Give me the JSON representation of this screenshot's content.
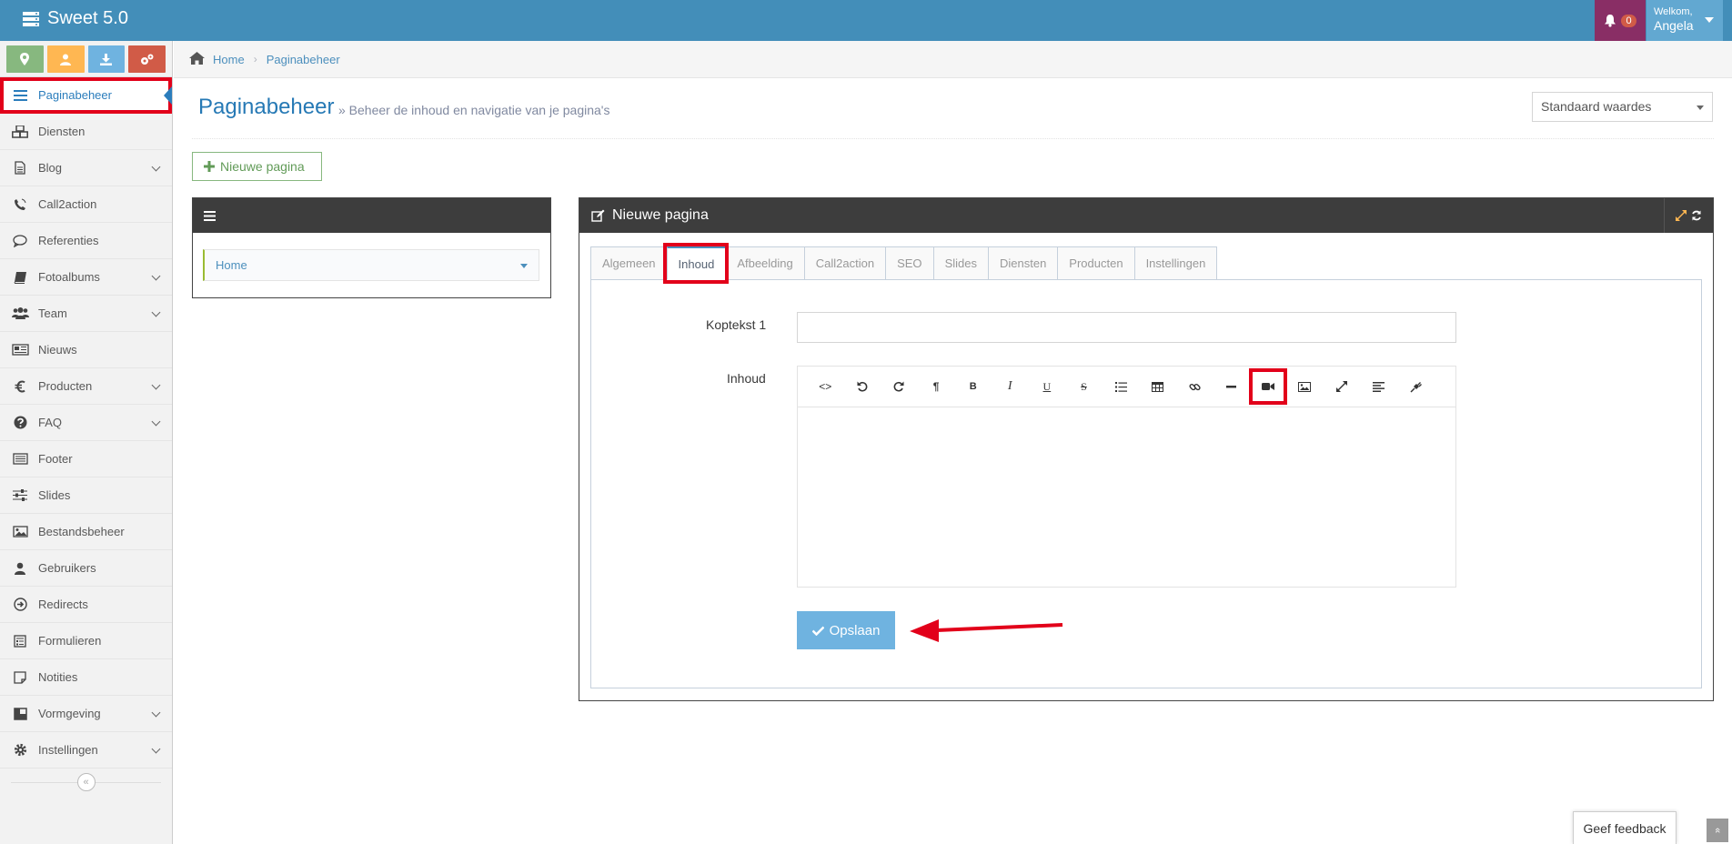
{
  "app": {
    "title": "Sweet 5.0"
  },
  "header": {
    "notifications_count": "0",
    "welcome_label": "Welkom,",
    "user_name": "Angela"
  },
  "sidebar": {
    "items": [
      {
        "label": "Paginabeheer",
        "icon": "list-icon",
        "active": true,
        "has_sub": false
      },
      {
        "label": "Diensten",
        "icon": "cubes-icon",
        "has_sub": false
      },
      {
        "label": "Blog",
        "icon": "file-text-icon",
        "has_sub": true
      },
      {
        "label": "Call2action",
        "icon": "phone-volume-icon",
        "has_sub": false
      },
      {
        "label": "Referenties",
        "icon": "comment-icon",
        "has_sub": false
      },
      {
        "label": "Fotoalbums",
        "icon": "book-icon",
        "has_sub": true
      },
      {
        "label": "Team",
        "icon": "users-icon",
        "has_sub": true
      },
      {
        "label": "Nieuws",
        "icon": "newspaper-icon",
        "has_sub": false
      },
      {
        "label": "Producten",
        "icon": "euro-icon",
        "has_sub": true
      },
      {
        "label": "FAQ",
        "icon": "question-circle-icon",
        "has_sub": true
      },
      {
        "label": "Footer",
        "icon": "list-alt-icon",
        "has_sub": false
      },
      {
        "label": "Slides",
        "icon": "sliders-icon",
        "has_sub": false
      },
      {
        "label": "Bestandsbeheer",
        "icon": "image-icon",
        "has_sub": false
      },
      {
        "label": "Gebruikers",
        "icon": "user-icon",
        "has_sub": false
      },
      {
        "label": "Redirects",
        "icon": "arrow-circle-icon",
        "has_sub": false
      },
      {
        "label": "Formulieren",
        "icon": "form-icon",
        "has_sub": false
      },
      {
        "label": "Notities",
        "icon": "sticky-note-icon",
        "has_sub": false
      },
      {
        "label": "Vormgeving",
        "icon": "columns-icon",
        "has_sub": true
      },
      {
        "label": "Instellingen",
        "icon": "gear-icon",
        "has_sub": true
      }
    ]
  },
  "breadcrumb": {
    "home": "Home",
    "current": "Paginabeheer"
  },
  "page": {
    "title": "Paginabeheer",
    "subtitle": "» Beheer de inhoud en navigatie van je pagina's",
    "defaults_select": "Standaard waardes",
    "new_page_button": "Nieuwe pagina"
  },
  "tree": {
    "item": "Home"
  },
  "form_widget": {
    "title": "Nieuwe pagina",
    "tabs": [
      "Algemeen",
      "Inhoud",
      "Afbeelding",
      "Call2action",
      "SEO",
      "Slides",
      "Diensten",
      "Producten",
      "Instellingen"
    ],
    "active_tab": "Inhoud",
    "koptekst_label": "Koptekst 1",
    "koptekst_value": "",
    "inhoud_label": "Inhoud",
    "save_button": "Opslaan"
  },
  "footer": {
    "feedback": "Geef feedback"
  },
  "colors": {
    "topbar": "#438eb9",
    "accent": "#2679b5",
    "highlight": "#e2001a",
    "save": "#6fb3e0"
  }
}
